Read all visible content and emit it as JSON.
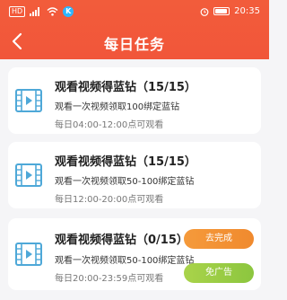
{
  "status": {
    "left_hd": "HD",
    "left_badge": "K",
    "time": "20:35"
  },
  "header": {
    "title": "每日任务"
  },
  "tasks": [
    {
      "title": "观看视频得蓝钻（15/15）",
      "subtitle": "观看一次视频领取100绑定蓝钻",
      "time": "每日04:00-12:00点可观看"
    },
    {
      "title": "观看视频得蓝钻（15/15）",
      "subtitle": "观看一次视频领取50-100绑定蓝钻",
      "time": "每日12:00-20:00点可观看"
    },
    {
      "title": "观看视频得蓝钻（0/15）",
      "subtitle": "观看一次视频领取50-100绑定蓝钻",
      "time": "每日20:00-23:59点可观看",
      "primary_button": "去完成",
      "secondary_button": "免广告"
    }
  ],
  "colors": {
    "header": "#f25c3b",
    "icon": "#4ea8d8",
    "btn_orange": "#f08a2e",
    "btn_green": "#8cc63f"
  }
}
